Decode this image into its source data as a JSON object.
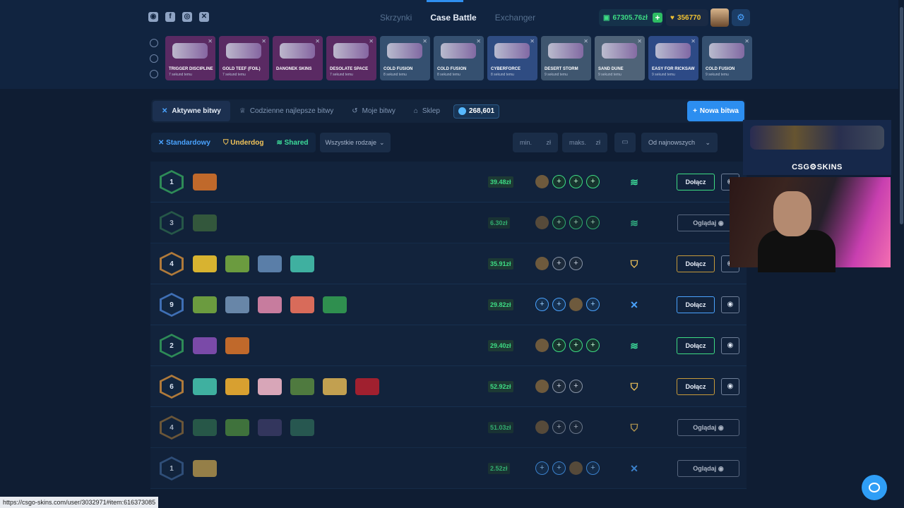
{
  "nav": {
    "tabs": [
      "Skrzynki",
      "Case Battle",
      "Exchanger"
    ],
    "active_tab": "Case Battle"
  },
  "wallet": {
    "balance": "67305.76zł",
    "coins": "356770"
  },
  "live_drops": [
    {
      "name": "TRIGGER DISCIPLINE",
      "sub": "7 sekund temu",
      "bg": "#5a2a63"
    },
    {
      "name": "GOLD TEEF (FOIL)",
      "sub": "7 sekund temu",
      "bg": "#5a2a63"
    },
    {
      "name": "DANONEK SKINS",
      "sub": "",
      "bg": "#5a2a63"
    },
    {
      "name": "DESOLATE SPACE",
      "sub": "7 sekund temu",
      "bg": "#5a2a63"
    },
    {
      "name": "COLD FUSION",
      "sub": "8 sekund temu",
      "bg": "#355070"
    },
    {
      "name": "COLD FUSION",
      "sub": "8 sekund temu",
      "bg": "#355070"
    },
    {
      "name": "CYBERFORCE",
      "sub": "8 sekund temu",
      "bg": "#2f4c82"
    },
    {
      "name": "DESERT STORM",
      "sub": "9 sekund temu",
      "bg": "#3f566f"
    },
    {
      "name": "SAND DUNE",
      "sub": "9 sekund temu",
      "bg": "#4f6378"
    },
    {
      "name": "EASY FOR RICKSAW",
      "sub": "9 sekund temu",
      "bg": "#2d4a86"
    },
    {
      "name": "COLD FUSION",
      "sub": "9 sekund temu",
      "bg": "#355070"
    }
  ],
  "tabs": {
    "active": "Aktywne bitwy",
    "best": "Codzienne najlepsze bitwy",
    "mine": "Moje bitwy",
    "shop": "Sklep",
    "shop_amount": "268,601",
    "new_battle": "Nowa bitwa"
  },
  "filters": {
    "standard": "Standardowy",
    "underdog": "Underdog",
    "shared": "Shared",
    "all_types": "Wszystkie rodzaje",
    "min": "min.",
    "max": "maks.",
    "currency": "zł",
    "sort": "Od najnowszych"
  },
  "battles": [
    {
      "round": "1",
      "value": "39.48zł",
      "mode": "shared",
      "action": "Dołącz",
      "cases": [
        "#c0692b"
      ]
    },
    {
      "round": "3",
      "value": "6.30zł",
      "mode": "shared",
      "action": "Oglądaj",
      "cases": [
        "#3f6b3f"
      ]
    },
    {
      "round": "4",
      "value": "35.91zł",
      "mode": "underdog",
      "action": "Dołącz",
      "cases": [
        "#d8b330",
        "#6b9b3f",
        "#5a7ea8",
        "#3fb0a0"
      ]
    },
    {
      "round": "9",
      "value": "29.82zł",
      "mode": "standard",
      "action": "Dołącz",
      "cases": [
        "#6b9b3f",
        "#6886a8",
        "#c77c9e",
        "#d86b5a",
        "#2f8f4f"
      ]
    },
    {
      "round": "2",
      "value": "29.40zł",
      "mode": "shared",
      "action": "Dołącz",
      "cases": [
        "#7a4aa8",
        "#c0692b"
      ]
    },
    {
      "round": "6",
      "value": "52.92zł",
      "mode": "underdog",
      "action": "Dołącz",
      "cases": [
        "#3fb0a0",
        "#d8a030",
        "#d8a6b8",
        "#4f7a3f",
        "#c2a050",
        "#a0202f"
      ]
    },
    {
      "round": "4",
      "value": "51.03zł",
      "mode": "underdog",
      "action": "Oglądaj",
      "cases": [
        "#2f6b4f",
        "#4f8f3f",
        "#3f3f6b",
        "#2f6b5a"
      ]
    },
    {
      "round": "1",
      "value": "2.52zł",
      "mode": "standard",
      "action": "Oglądaj",
      "cases": [
        "#c2a050"
      ]
    }
  ],
  "stream": {
    "brand": "CSG⚙SKINS"
  },
  "status_url": "https://csgo-skins.com/user/3032971#item:616373085"
}
